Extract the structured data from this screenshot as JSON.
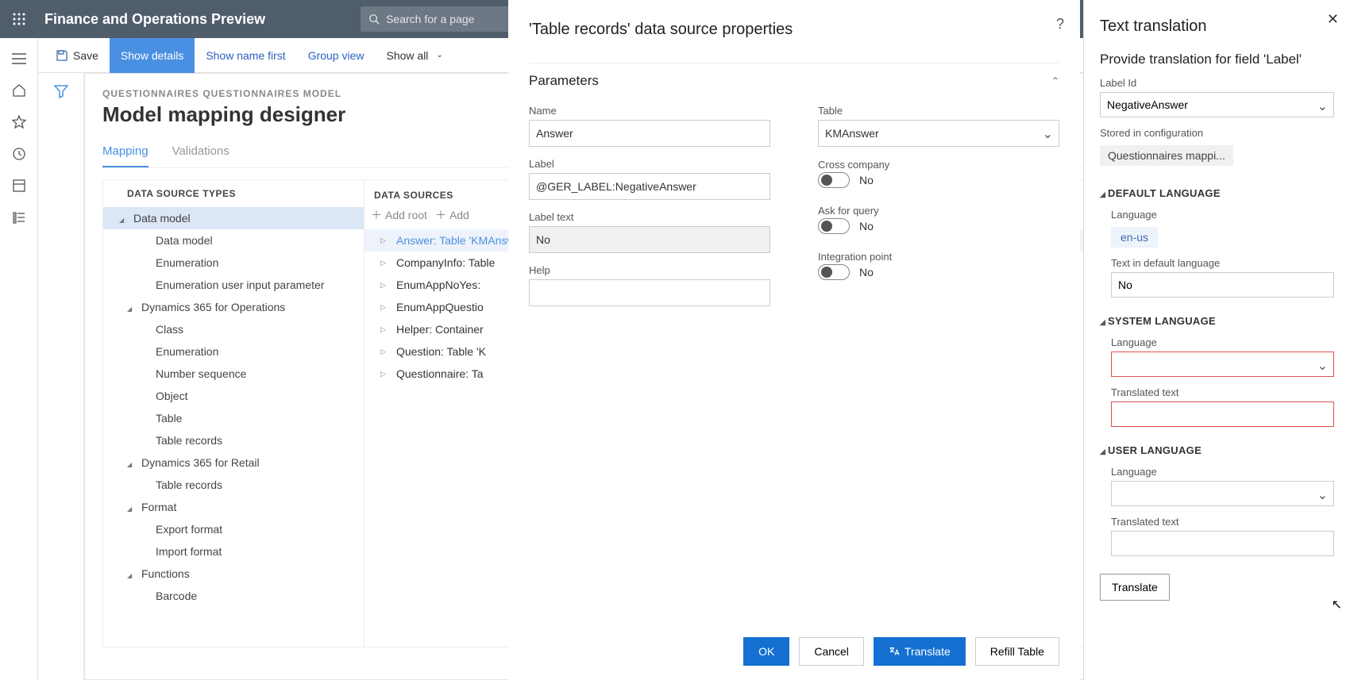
{
  "header": {
    "app_title": "Finance and Operations Preview",
    "search_placeholder": "Search for a page"
  },
  "commandbar": {
    "save": "Save",
    "show_details": "Show details",
    "show_name_first": "Show name first",
    "group_view": "Group view",
    "show_all": "Show all"
  },
  "page": {
    "breadcrumb": "QUESTIONNAIRES QUESTIONNAIRES MODEL",
    "title": "Model mapping designer",
    "tabs": {
      "mapping": "Mapping",
      "validations": "Validations"
    }
  },
  "tree": {
    "header": "DATA SOURCE TYPES",
    "data_model": "Data model",
    "data_model_child": "Data model",
    "enumeration1": "Enumeration",
    "enum_user_input": "Enumeration user input parameter",
    "d365ops": "Dynamics 365 for Operations",
    "class": "Class",
    "enumeration2": "Enumeration",
    "number_sequence": "Number sequence",
    "object": "Object",
    "table": "Table",
    "table_records1": "Table records",
    "d365retail": "Dynamics 365 for Retail",
    "table_records2": "Table records",
    "format": "Format",
    "export_format": "Export format",
    "import_format": "Import format",
    "functions": "Functions",
    "barcode": "Barcode"
  },
  "datasources": {
    "header": "DATA SOURCES",
    "add_root": "Add root",
    "add": "Add",
    "rows": {
      "answer": "Answer: Table 'KMAnswer'",
      "company": "CompanyInfo: Table",
      "enumyes": "EnumAppNoYes: ",
      "enumq": "EnumAppQuestio",
      "helper": "Helper: Container",
      "question": "Question: Table 'K",
      "questionnaire": "Questionnaire: Ta"
    }
  },
  "props": {
    "title": "'Table records' data source properties",
    "section": "Parameters",
    "name_label": "Name",
    "name_value": "Answer",
    "label_label": "Label",
    "label_value": "@GER_LABEL:NegativeAnswer",
    "labeltext_label": "Label text",
    "labeltext_value": "No",
    "help_label": "Help",
    "help_value": "",
    "table_label": "Table",
    "table_value": "KMAnswer",
    "crosscompany_label": "Cross company",
    "crosscompany_value": "No",
    "askforquery_label": "Ask for query",
    "askforquery_value": "No",
    "integration_label": "Integration point",
    "integration_value": "No",
    "ok": "OK",
    "cancel": "Cancel",
    "translate": "Translate",
    "refill": "Refill Table"
  },
  "translation": {
    "title": "Text translation",
    "subtitle": "Provide translation for field 'Label'",
    "labelid_label": "Label Id",
    "labelid_value": "NegativeAnswer",
    "stored_label": "Stored in configuration",
    "stored_value": "Questionnaires mappi...",
    "section_default": "DEFAULT LANGUAGE",
    "language_label": "Language",
    "default_lang": "en-us",
    "textdefault_label": "Text in default language",
    "textdefault_value": "No",
    "section_system": "SYSTEM LANGUAGE",
    "system_lang_value": "",
    "translated_text_label": "Translated text",
    "translated_text_value": "",
    "section_user": "USER LANGUAGE",
    "user_lang_value": "",
    "user_translated_value": "",
    "translate_btn": "Translate"
  }
}
